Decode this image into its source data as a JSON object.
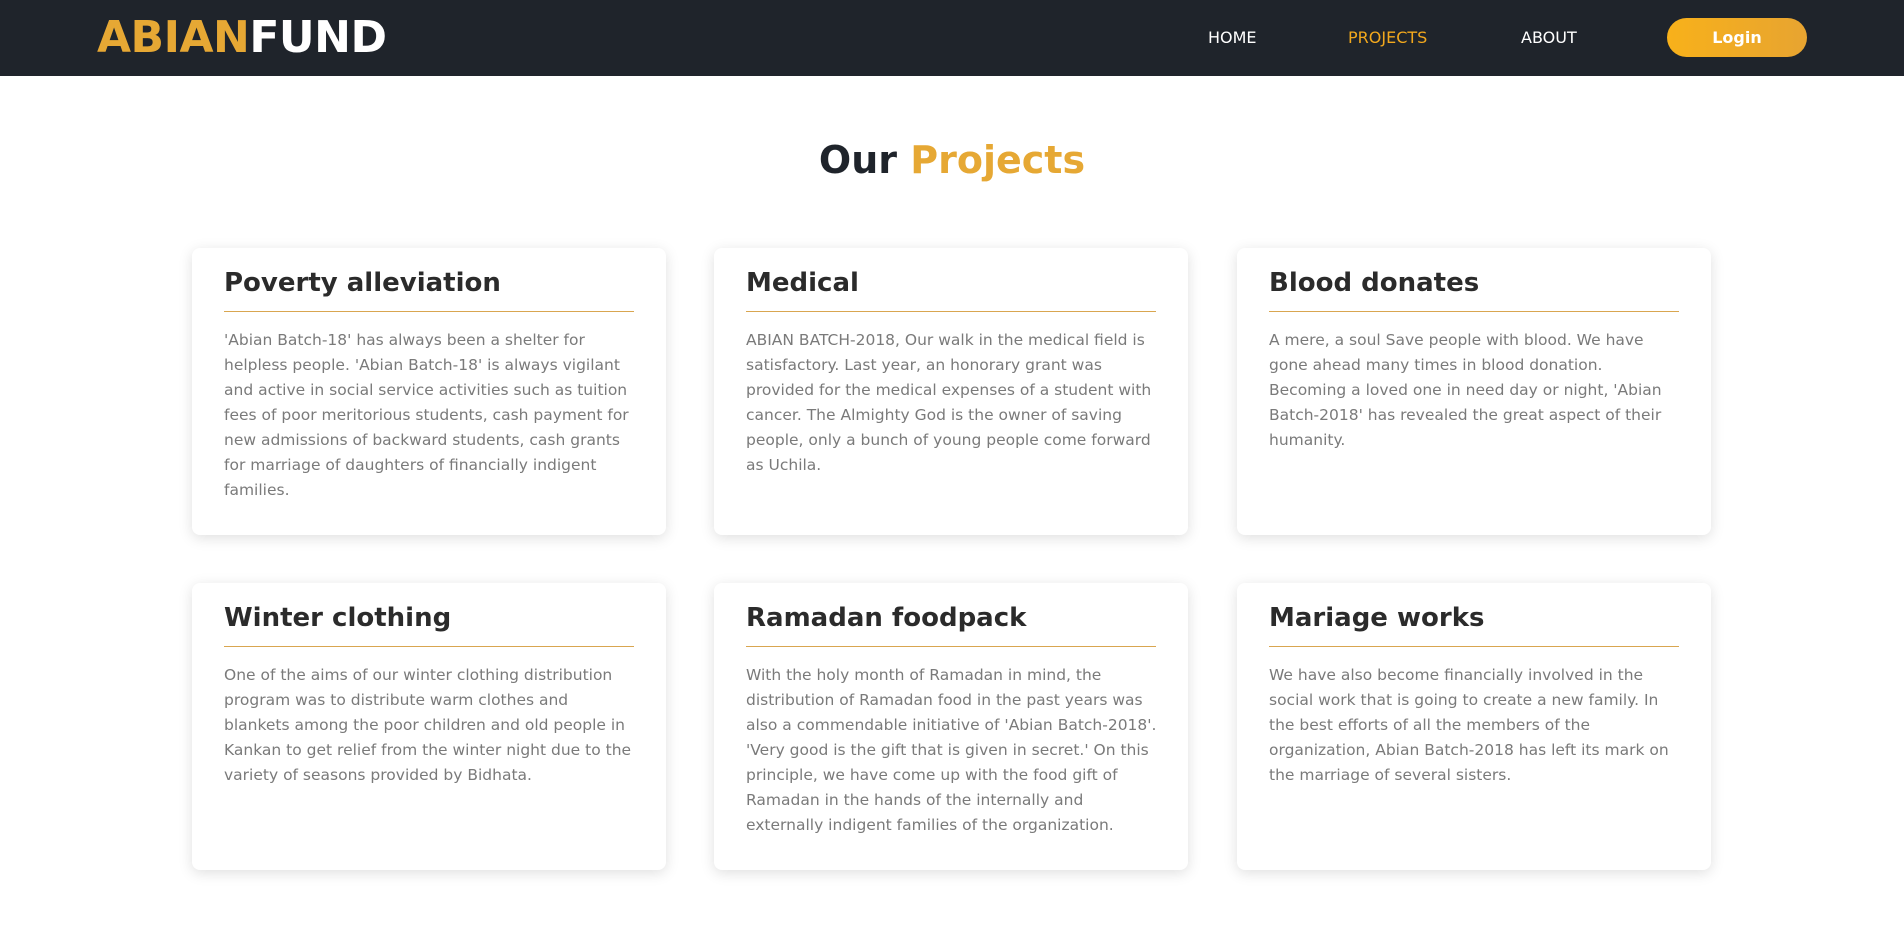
{
  "brand": {
    "part1": "ABIAN",
    "part2": "FUND"
  },
  "nav": {
    "home": "HOME",
    "projects": "PROJECTS",
    "about": "ABOUT",
    "login": "Login"
  },
  "colors": {
    "navbar_bg": "#1f242b",
    "accent": "#e6a834",
    "nav_active": "#f2a81d",
    "card_rule": "#d9a650"
  },
  "page": {
    "title_part1": "Our",
    "title_part2": "Projects"
  },
  "cards": [
    {
      "title": "Poverty alleviation",
      "text": "'Abian Batch-18' has always been a shelter for helpless people. 'Abian Batch-18' is always vigilant and active in social service activities such as tuition fees of poor meritorious students, cash payment for new admissions of backward students, cash grants for marriage of daughters of financially indigent families."
    },
    {
      "title": "Medical",
      "text": "ABIAN BATCH-2018, Our walk in the medical field is satisfactory. Last year, an honorary grant was provided for the medical expenses of a student with cancer. The Almighty God is the owner of saving people, only a bunch of young people come forward as Uchila."
    },
    {
      "title": "Blood donates",
      "text": "A mere, a soul Save people with blood. We have gone ahead many times in blood donation. Becoming a loved one in need day or night, 'Abian Batch-2018' has revealed the great aspect of their humanity."
    },
    {
      "title": "Winter clothing",
      "text": "One of the aims of our winter clothing distribution program was to distribute warm clothes and blankets among the poor children and old people in Kankan to get relief from the winter night due to the variety of seasons provided by Bidhata."
    },
    {
      "title": "Ramadan foodpack",
      "text": "With the holy month of Ramadan in mind, the distribution of Ramadan food in the past years was also a commendable initiative of 'Abian Batch-2018'. 'Very good is the gift that is given in secret.' On this principle, we have come up with the food gift of Ramadan in the hands of the internally and externally indigent families of the organization."
    },
    {
      "title": "Mariage works",
      "text": "We have also become financially involved in the social work that is going to create a new family. In the best efforts of all the members of the organization, Abian Batch-2018 has left its mark on the marriage of several sisters."
    }
  ]
}
